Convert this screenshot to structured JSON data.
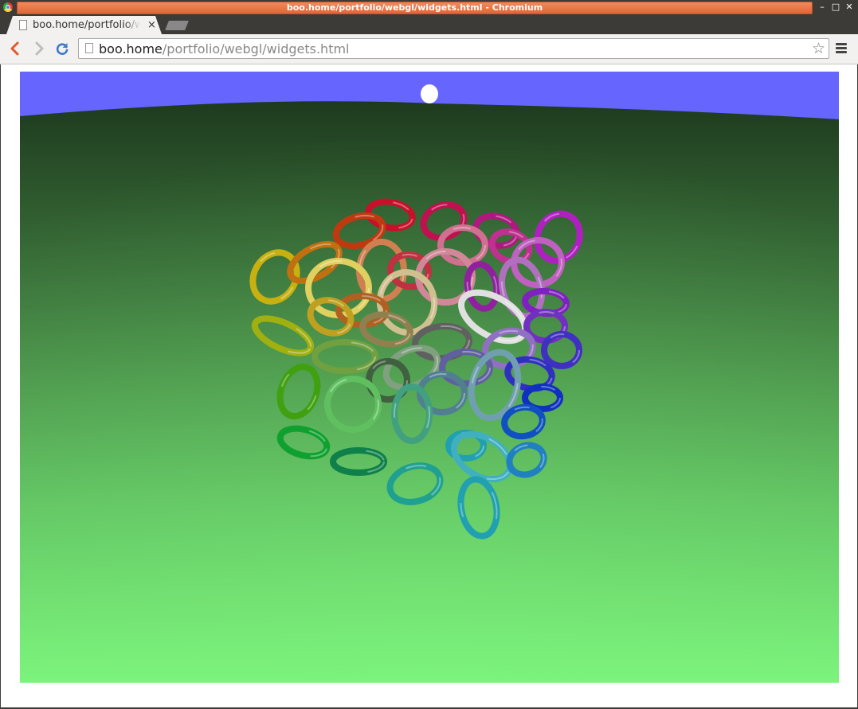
{
  "window": {
    "title": "boo.home/portfolio/webgl/widgets.html - Chromium",
    "controls": {
      "minimize": "–",
      "maximize": "□",
      "close": "✕"
    }
  },
  "tabs": [
    {
      "label": "boo.home/portfolio/widgets.html",
      "close": "×"
    }
  ],
  "toolbar": {
    "back": "‹",
    "forward": "›",
    "reload": "↻",
    "url_host": "boo.home",
    "url_path": "/portfolio/webgl/widgets.html",
    "star": "☆"
  },
  "scene": {
    "sky_color": "#6666ff",
    "ground_top_color": "#203e20",
    "ground_bottom_color": "#7cf47c",
    "sun_color": "#ffffff",
    "object": "colored torus rings cluster"
  },
  "colors": {
    "title_accent": "#e8703f",
    "back_icon": "#e05a2a",
    "reload_icon": "#3b7ac8"
  }
}
